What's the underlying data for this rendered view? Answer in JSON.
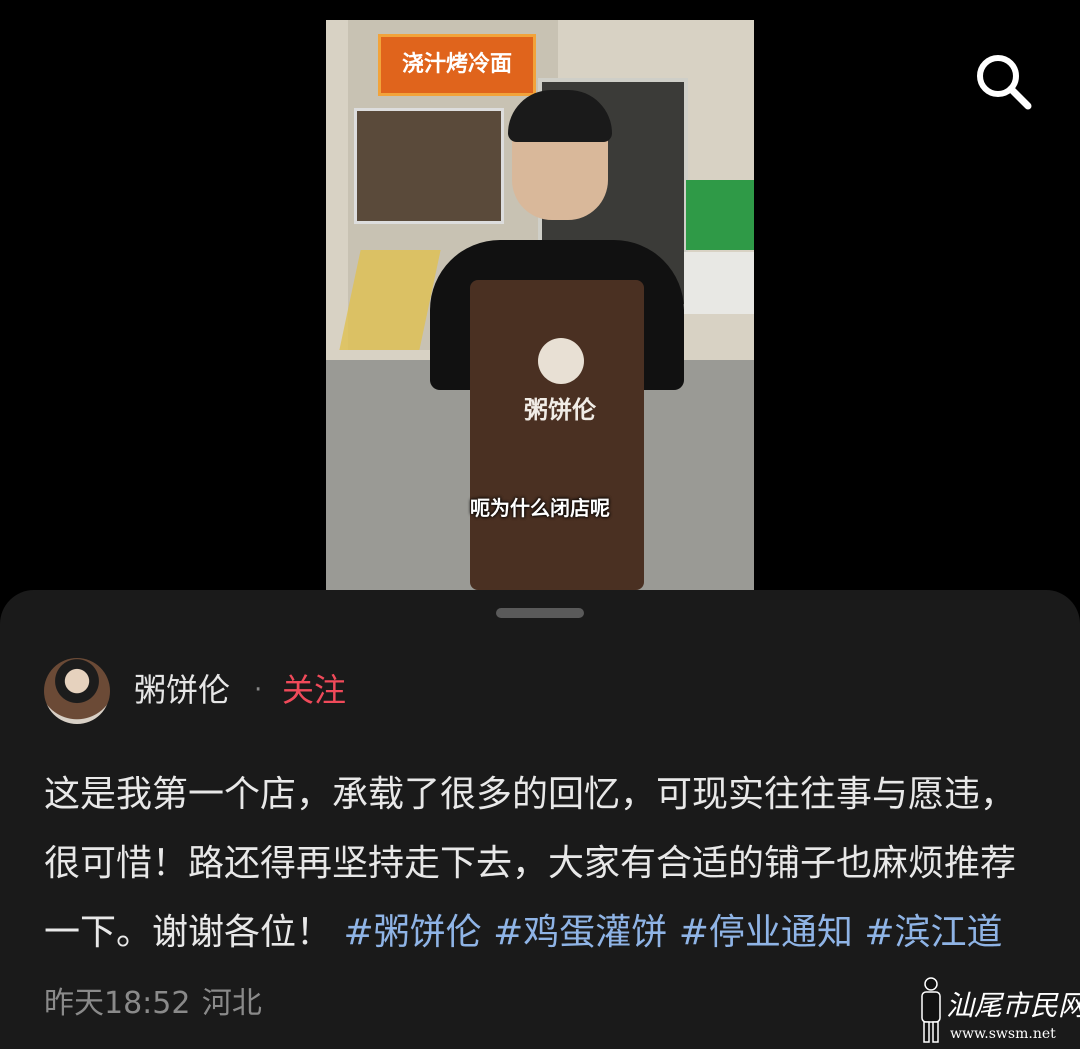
{
  "video": {
    "subtitle": "呃为什么闭店呢",
    "shop_sign": "浇汁烤冷面",
    "apron_text": "粥饼伦"
  },
  "toolbar": {
    "search_icon": "search-icon"
  },
  "post": {
    "username": "粥饼伦",
    "separator": "·",
    "follow_label": "关注",
    "caption_text": "这是我第一个店，承载了很多的回忆，可现实往往事与愿违，很可惜！路还得再坚持走下去，大家有合适的铺子也麻烦推荐一下。谢谢各位！",
    "tags": [
      "#粥饼伦",
      "#鸡蛋灌饼",
      "#停业通知",
      "#滨江道"
    ],
    "time": "昨天18:52",
    "location": "河北"
  },
  "watermark": {
    "name": "汕尾市民网",
    "url": "www.swsm.net"
  },
  "colors": {
    "background": "#000000",
    "sheet": "#1a1a1a",
    "follow": "#f04a5a",
    "hashtag": "#8fb4e6",
    "meta": "#8a8a8a"
  }
}
